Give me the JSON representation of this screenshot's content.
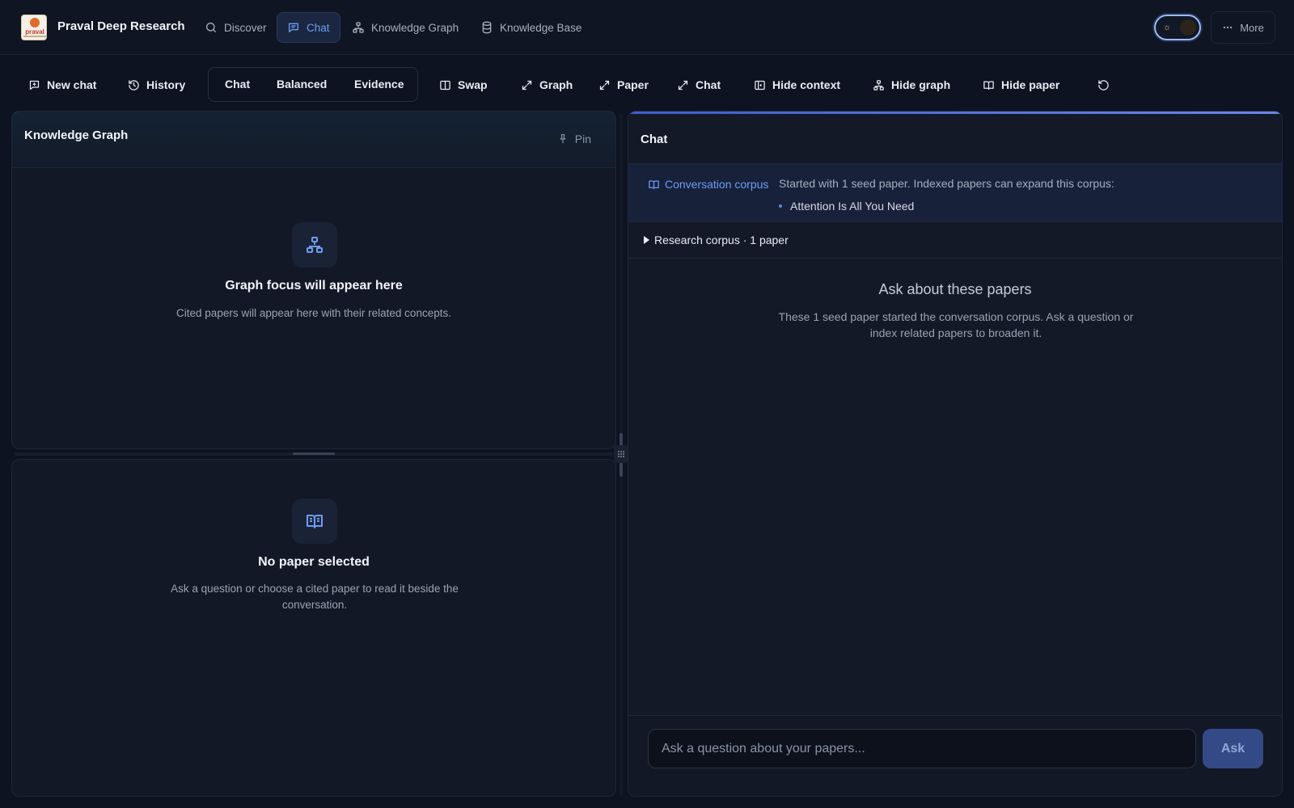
{
  "app": {
    "brand": "Praval Deep Research",
    "logo_text": "praval"
  },
  "nav": {
    "items": [
      {
        "label": "Discover",
        "icon": "search-icon"
      },
      {
        "label": "Chat",
        "icon": "chat-icon",
        "active": true
      },
      {
        "label": "Knowledge Graph",
        "icon": "graph-icon"
      },
      {
        "label": "Knowledge Base",
        "icon": "database-icon"
      }
    ],
    "more_label": "More"
  },
  "toolbar": {
    "new_chat": "New chat",
    "history": "History",
    "modes": [
      "Chat",
      "Balanced",
      "Evidence"
    ],
    "swap": "Swap",
    "expand_graph": "Graph",
    "expand_paper": "Paper",
    "expand_chat": "Chat",
    "hide_context": "Hide context",
    "hide_graph": "Hide graph",
    "hide_paper": "Hide paper"
  },
  "graph_panel": {
    "title": "Knowledge Graph",
    "pin_label": "Pin",
    "empty_title": "Graph focus will appear here",
    "empty_desc": "Cited papers will appear here with their related concepts."
  },
  "paper_panel": {
    "empty_title": "No paper selected",
    "empty_desc": "Ask a question or choose a cited paper to read it beside the conversation."
  },
  "chat_panel": {
    "title": "Chat",
    "corpus_label": "Conversation corpus",
    "corpus_desc": "Started with 1 seed paper. Indexed papers can expand this corpus:",
    "corpus_papers": [
      "Attention Is All You Need"
    ],
    "research_corpus": "Research corpus · 1 paper",
    "ask_title": "Ask about these papers",
    "ask_desc": "These 1 seed paper started the conversation corpus. Ask a question or index related papers to broaden it.",
    "input_placeholder": "Ask a question about your papers...",
    "input_value": "",
    "ask_button": "Ask"
  },
  "colors": {
    "background": "#0d1320",
    "panel": "#121826",
    "accent": "#6d9cf5",
    "ask_button": "#334a87"
  }
}
